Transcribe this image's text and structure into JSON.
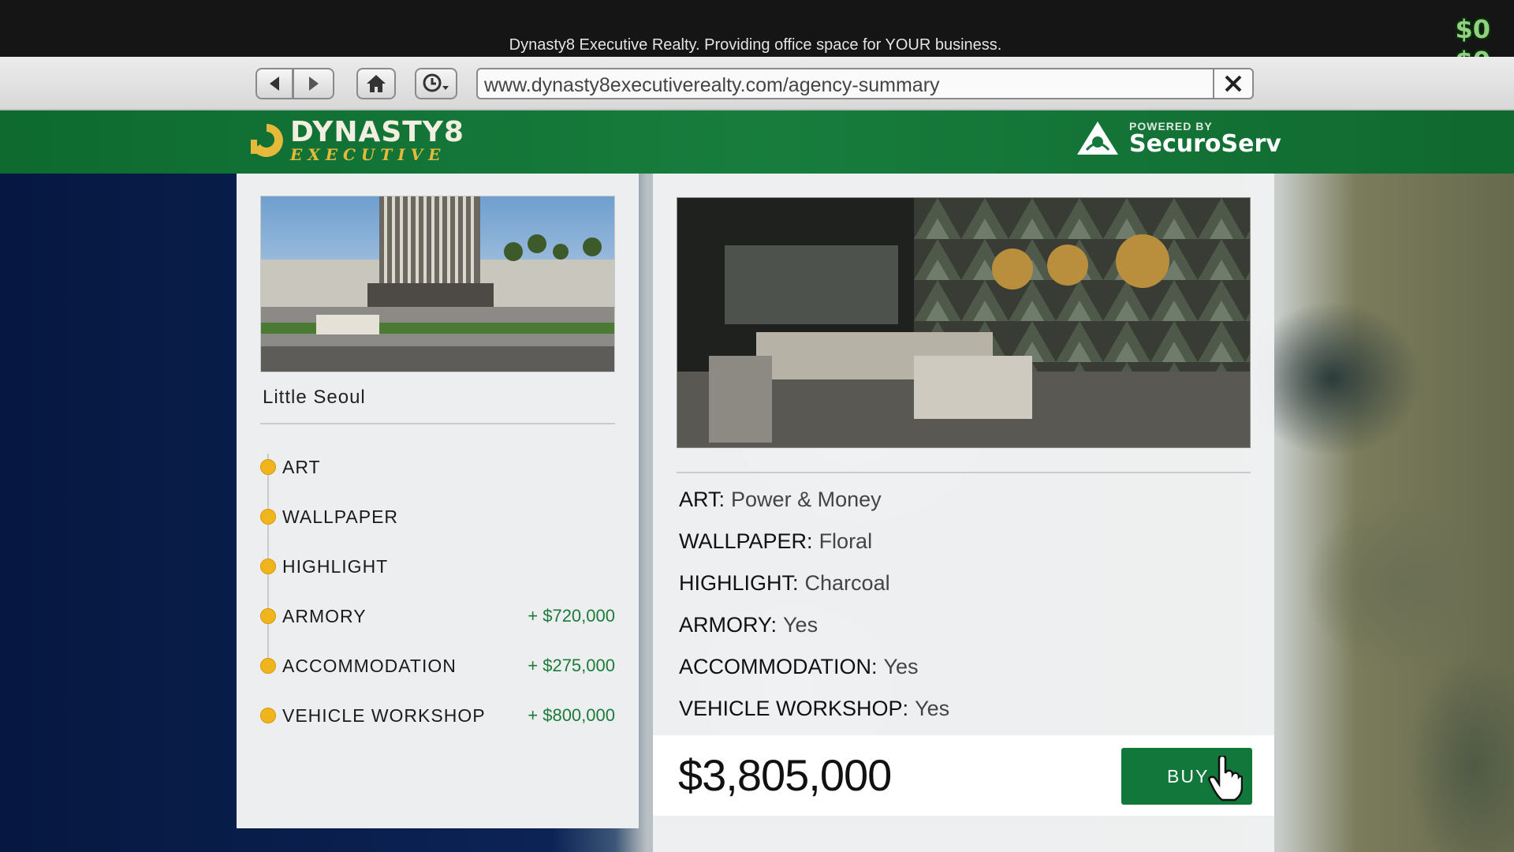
{
  "window": {
    "title": "Dynasty8 Executive Realty. Providing office space for YOUR business.",
    "cash_top": "$0",
    "cash_bottom": "$0"
  },
  "browser": {
    "url": "www.dynasty8executiverealty.com/agency-summary"
  },
  "header": {
    "logo_main": "DYNASTY8",
    "logo_sub": "EXECUTIVE",
    "powered_by": "POWERED BY",
    "partner": "SecuroServ"
  },
  "property": {
    "name": "Little Seoul",
    "options": [
      {
        "label": "ART",
        "price": ""
      },
      {
        "label": "WALLPAPER",
        "price": ""
      },
      {
        "label": "HIGHLIGHT",
        "price": ""
      },
      {
        "label": "ARMORY",
        "price": "+ $720,000"
      },
      {
        "label": "ACCOMMODATION",
        "price": "+ $275,000"
      },
      {
        "label": "VEHICLE WORKSHOP",
        "price": "+ $800,000"
      }
    ]
  },
  "summary": {
    "rows": [
      {
        "key": "ART:",
        "value": "Power & Money"
      },
      {
        "key": "WALLPAPER:",
        "value": "Floral"
      },
      {
        "key": "HIGHLIGHT:",
        "value": "Charcoal"
      },
      {
        "key": "ARMORY:",
        "value": "Yes"
      },
      {
        "key": "ACCOMMODATION:",
        "value": "Yes"
      },
      {
        "key": "VEHICLE WORKSHOP:",
        "value": "Yes"
      }
    ],
    "total": "$3,805,000",
    "buy_label": "BUY"
  },
  "colors": {
    "brand_green": "#12773a",
    "accent_gold": "#f0b51c",
    "price_green": "#1d7b3a"
  }
}
